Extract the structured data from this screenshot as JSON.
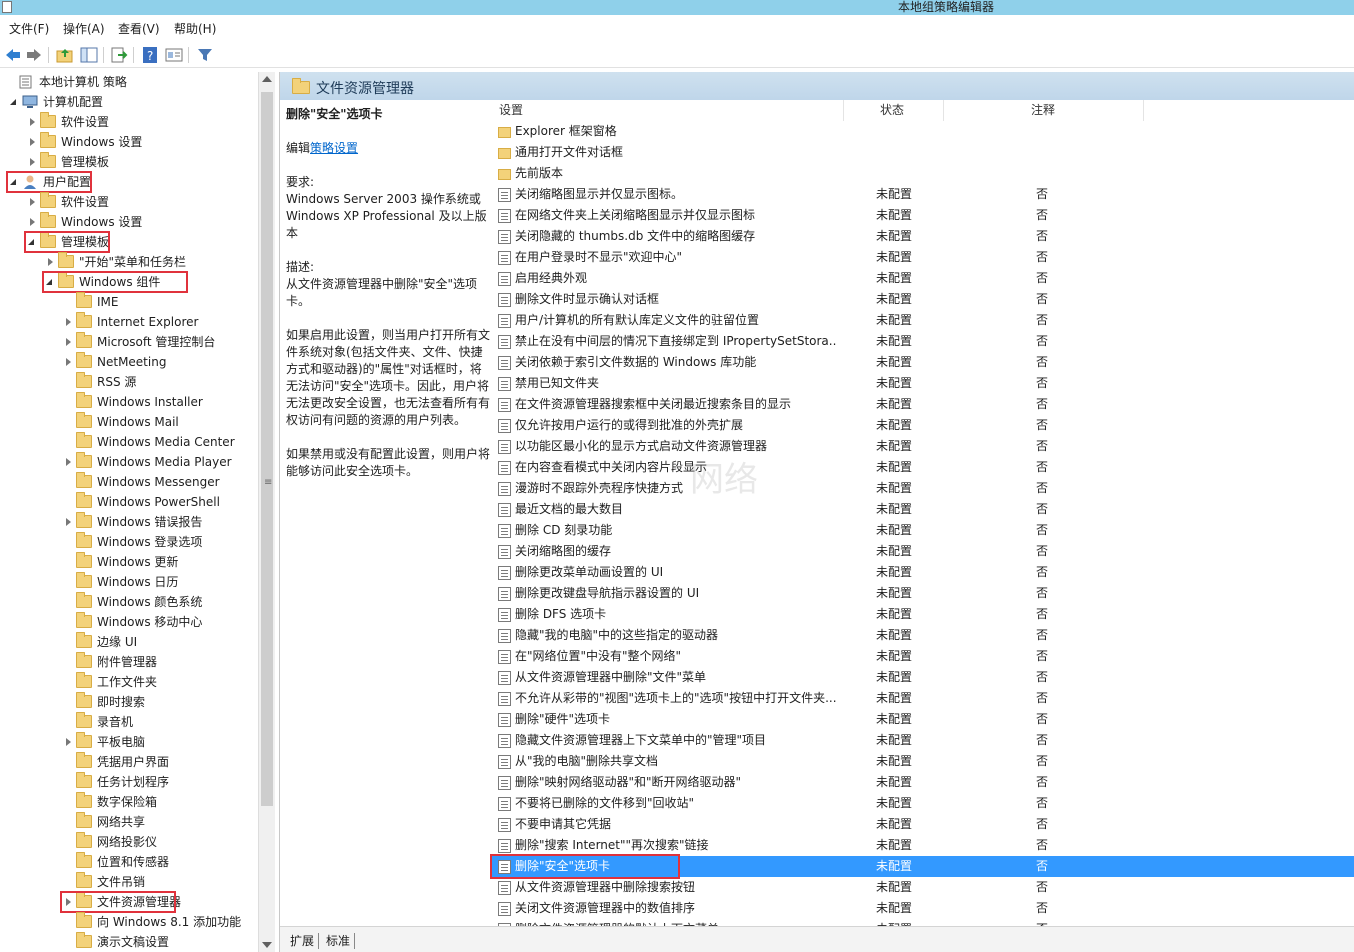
{
  "window": {
    "title": "本地组策略编辑器"
  },
  "menu": [
    "文件(F)",
    "操作(A)",
    "查看(V)",
    "帮助(H)"
  ],
  "toolbar": {
    "icons": [
      "back-arrow-icon",
      "forward-arrow-icon",
      "up-folder-icon",
      "show-hide-tree-icon",
      "export-list-icon",
      "help-icon",
      "properties-icon",
      "filter-icon"
    ]
  },
  "tree": [
    {
      "label": "本地计算机 策略",
      "level": 0,
      "exp": "none",
      "icon": "computer-policy"
    },
    {
      "label": "计算机配置",
      "level": 1,
      "exp": "expanded",
      "icon": "computer"
    },
    {
      "label": "软件设置",
      "level": 2,
      "exp": "collapsed",
      "icon": "folder"
    },
    {
      "label": "Windows 设置",
      "level": 2,
      "exp": "collapsed",
      "icon": "folder"
    },
    {
      "label": "管理模板",
      "level": 2,
      "exp": "collapsed",
      "icon": "folder"
    },
    {
      "label": "用户配置",
      "level": 1,
      "exp": "expanded",
      "icon": "user",
      "highlight": true
    },
    {
      "label": "软件设置",
      "level": 2,
      "exp": "collapsed",
      "icon": "folder"
    },
    {
      "label": "Windows 设置",
      "level": 2,
      "exp": "collapsed",
      "icon": "folder"
    },
    {
      "label": "管理模板",
      "level": 2,
      "exp": "expanded",
      "icon": "folder",
      "highlight": true
    },
    {
      "label": "\"开始\"菜单和任务栏",
      "level": 3,
      "exp": "collapsed",
      "icon": "folder"
    },
    {
      "label": "Windows 组件",
      "level": 3,
      "exp": "expanded",
      "icon": "folder",
      "highlight": true
    },
    {
      "label": "IME",
      "level": 4,
      "exp": "none",
      "icon": "folder"
    },
    {
      "label": "Internet Explorer",
      "level": 4,
      "exp": "collapsed",
      "icon": "folder"
    },
    {
      "label": "Microsoft 管理控制台",
      "level": 4,
      "exp": "collapsed",
      "icon": "folder"
    },
    {
      "label": "NetMeeting",
      "level": 4,
      "exp": "collapsed",
      "icon": "folder"
    },
    {
      "label": "RSS 源",
      "level": 4,
      "exp": "none",
      "icon": "folder"
    },
    {
      "label": "Windows Installer",
      "level": 4,
      "exp": "none",
      "icon": "folder"
    },
    {
      "label": "Windows Mail",
      "level": 4,
      "exp": "none",
      "icon": "folder"
    },
    {
      "label": "Windows Media Center",
      "level": 4,
      "exp": "none",
      "icon": "folder"
    },
    {
      "label": "Windows Media Player",
      "level": 4,
      "exp": "collapsed",
      "icon": "folder"
    },
    {
      "label": "Windows Messenger",
      "level": 4,
      "exp": "none",
      "icon": "folder"
    },
    {
      "label": "Windows PowerShell",
      "level": 4,
      "exp": "none",
      "icon": "folder"
    },
    {
      "label": "Windows 错误报告",
      "level": 4,
      "exp": "collapsed",
      "icon": "folder"
    },
    {
      "label": "Windows 登录选项",
      "level": 4,
      "exp": "none",
      "icon": "folder"
    },
    {
      "label": "Windows 更新",
      "level": 4,
      "exp": "none",
      "icon": "folder"
    },
    {
      "label": "Windows 日历",
      "level": 4,
      "exp": "none",
      "icon": "folder"
    },
    {
      "label": "Windows 颜色系统",
      "level": 4,
      "exp": "none",
      "icon": "folder"
    },
    {
      "label": "Windows 移动中心",
      "level": 4,
      "exp": "none",
      "icon": "folder"
    },
    {
      "label": "边缘 UI",
      "level": 4,
      "exp": "none",
      "icon": "folder"
    },
    {
      "label": "附件管理器",
      "level": 4,
      "exp": "none",
      "icon": "folder"
    },
    {
      "label": "工作文件夹",
      "level": 4,
      "exp": "none",
      "icon": "folder"
    },
    {
      "label": "即时搜索",
      "level": 4,
      "exp": "none",
      "icon": "folder"
    },
    {
      "label": "录音机",
      "level": 4,
      "exp": "none",
      "icon": "folder"
    },
    {
      "label": "平板电脑",
      "level": 4,
      "exp": "collapsed",
      "icon": "folder"
    },
    {
      "label": "凭据用户界面",
      "level": 4,
      "exp": "none",
      "icon": "folder"
    },
    {
      "label": "任务计划程序",
      "level": 4,
      "exp": "none",
      "icon": "folder"
    },
    {
      "label": "数字保险箱",
      "level": 4,
      "exp": "none",
      "icon": "folder"
    },
    {
      "label": "网络共享",
      "level": 4,
      "exp": "none",
      "icon": "folder"
    },
    {
      "label": "网络投影仪",
      "level": 4,
      "exp": "none",
      "icon": "folder"
    },
    {
      "label": "位置和传感器",
      "level": 4,
      "exp": "none",
      "icon": "folder"
    },
    {
      "label": "文件吊销",
      "level": 4,
      "exp": "none",
      "icon": "folder"
    },
    {
      "label": "文件资源管理器",
      "level": 4,
      "exp": "collapsed",
      "icon": "folder",
      "highlight": true
    },
    {
      "label": "向 Windows 8.1 添加功能",
      "level": 4,
      "exp": "none",
      "icon": "folder"
    },
    {
      "label": "演示文稿设置",
      "level": 4,
      "exp": "none",
      "icon": "folder"
    }
  ],
  "pane": {
    "title": "文件资源管理器",
    "desc": {
      "title": "删除\"安全\"选项卡",
      "edit_prefix": "编辑",
      "edit_link": "策略设置",
      "req_label": "要求:",
      "req_text": "Windows Server 2003 操作系统或 Windows XP Professional 及以上版本",
      "desc_label": "描述:",
      "desc_text": "从文件资源管理器中删除\"安全\"选项卡。",
      "enabled_text": "如果启用此设置，则当用户打开所有文件系统对象(包括文件夹、文件、快捷方式和驱动器)的\"属性\"对话框时，将无法访问\"安全\"选项卡。因此，用户将无法更改安全设置，也无法查看所有有权访问有问题的资源的用户列表。",
      "disabled_text": "如果禁用或没有配置此设置，则用户将能够访问此安全选项卡。"
    },
    "columns": {
      "setting": "设置",
      "state": "状态",
      "note": "注释"
    },
    "folders": [
      "Explorer 框架窗格",
      "通用打开文件对话框",
      "先前版本"
    ],
    "default_state": "未配置",
    "default_note": "否",
    "settings": [
      "关闭缩略图显示并仅显示图标。",
      "在网络文件夹上关闭缩略图显示并仅显示图标",
      "关闭隐藏的 thumbs.db 文件中的缩略图缓存",
      "在用户登录时不显示\"欢迎中心\"",
      "启用经典外观",
      "删除文件时显示确认对话框",
      "用户/计算机的所有默认库定义文件的驻留位置",
      "禁止在没有中间层的情况下直接绑定到 IPropertySetStora...",
      "关闭依赖于索引文件数据的 Windows 库功能",
      "禁用已知文件夹",
      "在文件资源管理器搜索框中关闭最近搜索条目的显示",
      "仅允许按用户运行的或得到批准的外壳扩展",
      "以功能区最小化的显示方式启动文件资源管理器",
      "在内容查看模式中关闭内容片段显示",
      "漫游时不跟踪外壳程序快捷方式",
      "最近文档的最大数目",
      "删除 CD 刻录功能",
      "关闭缩略图的缓存",
      "删除更改菜单动画设置的 UI",
      "删除更改键盘导航指示器设置的 UI",
      "删除 DFS 选项卡",
      "隐藏\"我的电脑\"中的这些指定的驱动器",
      "在\"网络位置\"中没有\"整个网络\"",
      "从文件资源管理器中删除\"文件\"菜单",
      "不允许从彩带的\"视图\"选项卡上的\"选项\"按钮中打开文件夹...",
      "删除\"硬件\"选项卡",
      "隐藏文件资源管理器上下文菜单中的\"管理\"项目",
      "从\"我的电脑\"删除共享文档",
      "删除\"映射网络驱动器\"和\"断开网络驱动器\"",
      "不要将已删除的文件移到\"回收站\"",
      "不要申请其它凭据",
      "删除\"搜索 Internet\"\"再次搜索\"链接",
      "删除\"安全\"选项卡",
      "从文件资源管理器中删除搜索按钮",
      "关闭文件资源管理器中的数值排序",
      "删除文件资源管理器的默认上下文菜单"
    ],
    "selected_setting": "删除\"安全\"选项卡"
  },
  "tabs": [
    "扩展",
    "标准"
  ],
  "watermark": "网络"
}
